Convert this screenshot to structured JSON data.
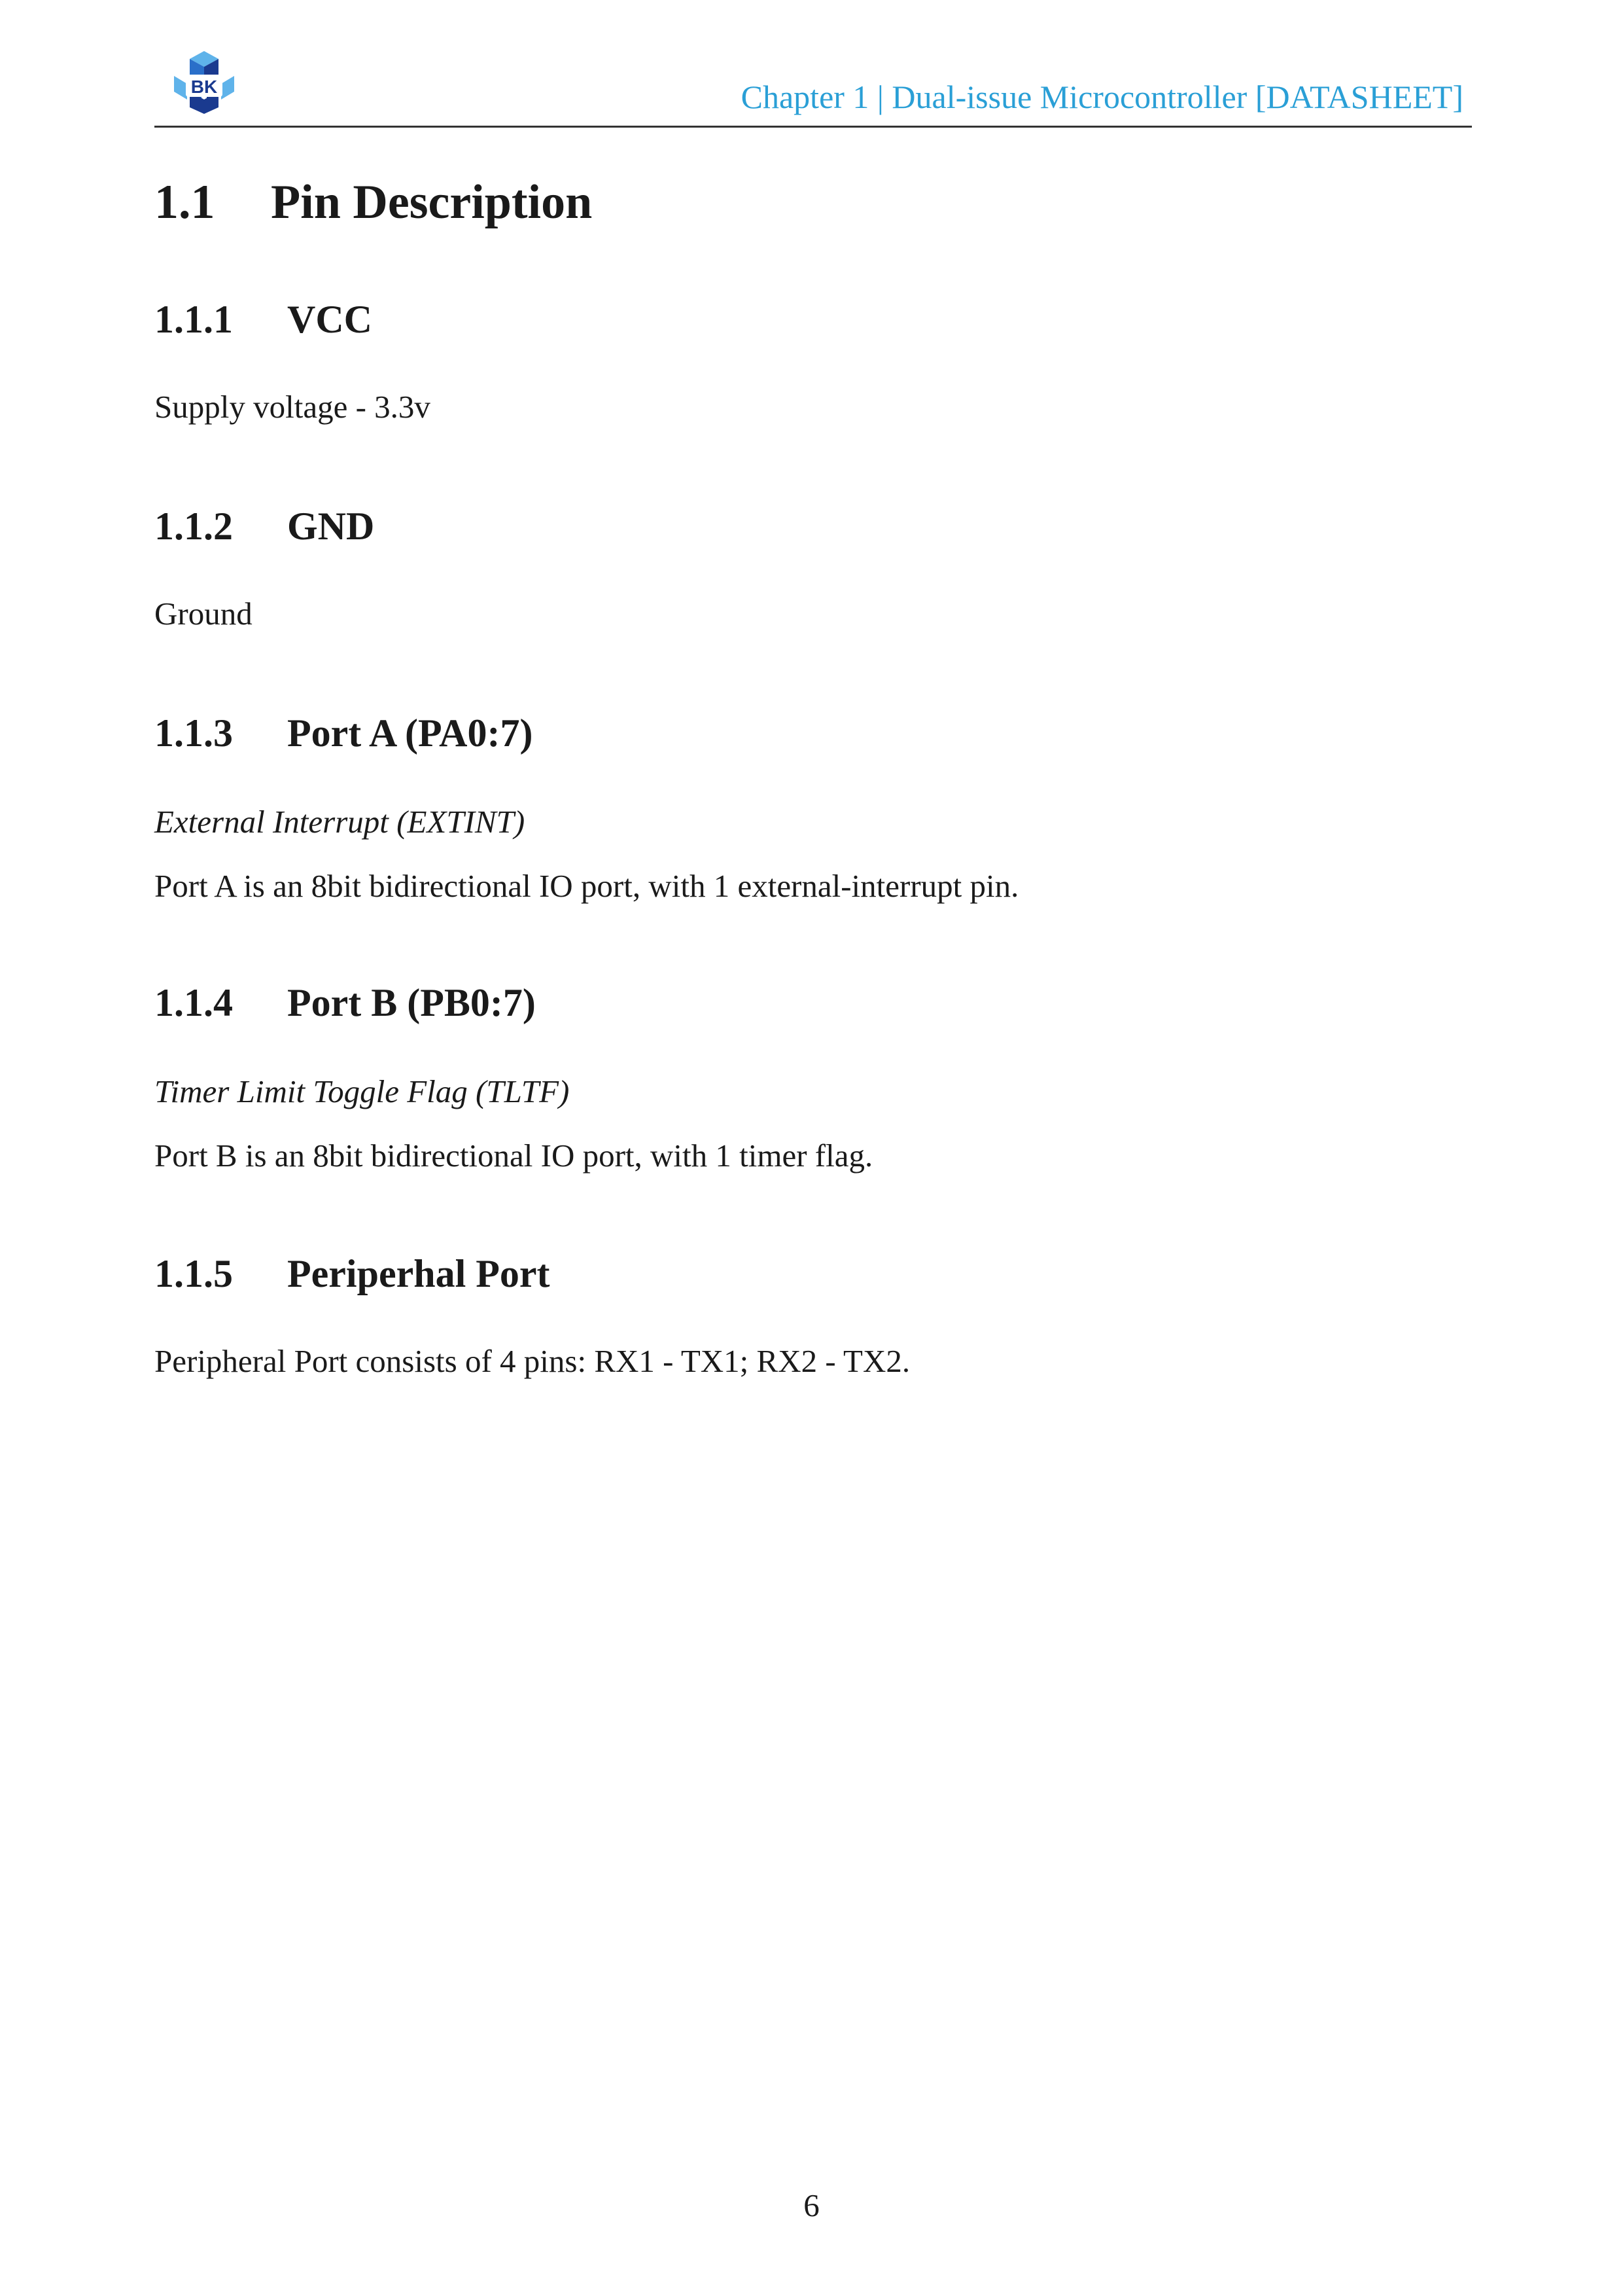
{
  "header": {
    "logo_text": "BK",
    "logo_colors": [
      "#1a3a8f",
      "#2a6fc9",
      "#5fb3ea"
    ],
    "title": "Chapter 1  | Dual-issue Microcontroller [DATASHEET]",
    "title_color": "#2a9fd6"
  },
  "section": {
    "number": "1.1",
    "title": "Pin Description"
  },
  "subsections": [
    {
      "number": "1.1.1",
      "title": "VCC",
      "subtitle": "",
      "body": "Supply voltage - 3.3v"
    },
    {
      "number": "1.1.2",
      "title": "GND",
      "subtitle": "",
      "body": "Ground"
    },
    {
      "number": "1.1.3",
      "title": "Port A (PA0:7)",
      "subtitle": "External Interrupt (EXTINT)",
      "body": "Port A is an 8bit bidirectional IO port, with 1 external-interrupt pin."
    },
    {
      "number": "1.1.4",
      "title": "Port B (PB0:7)",
      "subtitle": "Timer Limit Toggle Flag (TLTF)",
      "body": "Port B is an 8bit bidirectional IO port, with 1 timer flag."
    },
    {
      "number": "1.1.5",
      "title": "Periperhal Port",
      "subtitle": "",
      "body": "Peripheral Port consists of 4 pins: RX1 - TX1; RX2 - TX2."
    }
  ],
  "page_number": "6"
}
